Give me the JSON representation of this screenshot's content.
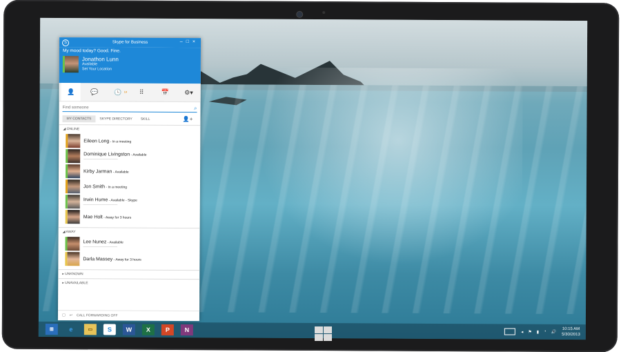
{
  "skype": {
    "window_title": "Skype for Business",
    "mood": "My mood today? Good. Fine.",
    "user_name": "Jonathon Lunn",
    "user_status": "Available",
    "user_location": "Set Your Location",
    "search_placeholder": "Find someone",
    "tabs": [
      "MY CONTACTS",
      "SKYPE DIRECTORY",
      "SKILL"
    ],
    "groups": {
      "online": "ONLINE",
      "away": "AWAY",
      "unknown": "UNKNOWN",
      "unavailable": "UNAVAILABLE"
    },
    "online_contacts": [
      {
        "name": "Eileen Long",
        "status": "In a meeting"
      },
      {
        "name": "Dominique Livingston",
        "status": "Available"
      },
      {
        "name": "Kirby Jarman",
        "status": "Available"
      },
      {
        "name": "Jon Smith",
        "status": "In a meeting"
      },
      {
        "name": "Irwin Hume",
        "status": "Available - Skype"
      },
      {
        "name": "Mae Holt",
        "status": "Away for 3 hours"
      }
    ],
    "away_contacts": [
      {
        "name": "Lee Nunez",
        "status": "Available"
      },
      {
        "name": "Darla Massey",
        "status": "Away for 3 hours"
      }
    ],
    "footer": "CALL FORWARDING OFF"
  },
  "taskbar": {
    "apps": [
      "windows-store",
      "internet-explorer",
      "file-explorer",
      "skype",
      "word",
      "excel",
      "powerpoint",
      "onenote"
    ],
    "time": "10:15 AM",
    "date": "5/30/2013"
  },
  "colors": {
    "skype_blue": "#1e88d8",
    "presence_available": "#6cc24a",
    "presence_busy": "#e2a21b"
  }
}
